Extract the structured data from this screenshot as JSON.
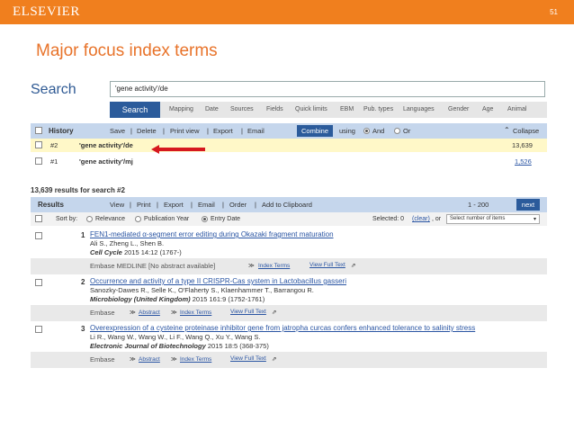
{
  "slide": {
    "brand": "ELSEVIER",
    "number": "51",
    "title": "Major focus index terms"
  },
  "search": {
    "label": "Search",
    "query": "'gene activity'/de",
    "button": "Search",
    "tabs": [
      "Mapping",
      "Date",
      "Sources",
      "Fields",
      "Quick limits",
      "EBM",
      "Pub. types",
      "Languages",
      "Gender",
      "Age",
      "Animal"
    ]
  },
  "history": {
    "label": "History",
    "actions": [
      "Save",
      "Delete",
      "Print view",
      "Export",
      "Email"
    ],
    "combine": "Combine",
    "using": "using",
    "and": "And",
    "or": "Or",
    "collapse": "Collapse",
    "rows": [
      {
        "id": "#2",
        "query": "'gene activity'/de",
        "count": "13,639"
      },
      {
        "id": "#1",
        "query": "'gene activity'/mj",
        "count": "1,526"
      }
    ]
  },
  "results": {
    "count_text": "13,639 results for search #2",
    "label": "Results",
    "actions": [
      "View",
      "Print",
      "Export",
      "Email",
      "Order",
      "Add to Clipboard"
    ],
    "range": "1 - 200",
    "next": "next",
    "sort_by": "Sort by:",
    "sort_options": [
      "Relevance",
      "Publication Year",
      "Entry Date"
    ],
    "selected_text": "Selected: 0",
    "clear": "(clear)",
    "or": ", or",
    "select_placeholder": "Select number of items",
    "items": [
      {
        "num": "1",
        "title": "FEN1-mediated α-segment error editing during Okazaki fragment maturation",
        "authors": "Ali S., Zheng L., Shen B.",
        "journal": "Cell Cycle",
        "journal_details": " 2015 14:12 (1767-)",
        "sources": "Embase   MEDLINE   [No abstract available]",
        "index_terms": "Index Terms",
        "full_text": "View Full Text"
      },
      {
        "num": "2",
        "title": "Occurrence and activity of a type II CRISPR-Cas system in Lactobacillus gasseri",
        "authors": "Sanozky-Dawes R., Selle K., O'Flaherty S., Klaenhammer T., Barrangou R.",
        "journal": "Microbiology (United Kingdom)",
        "journal_details": " 2015 161:9 (1752-1761)",
        "sources": "Embase",
        "abstract": "Abstract",
        "index_terms": "Index Terms",
        "full_text": "View Full Text"
      },
      {
        "num": "3",
        "title": "Overexpression of a cysteine proteinase inhibitor gene from jatropha curcas confers enhanced tolerance to salinity stress",
        "authors": "Li R., Wang W., Wang W., Li F., Wang Q., Xu Y., Wang S.",
        "journal": "Electronic Journal of Biotechnology",
        "journal_details": " 2015 18:5 (368-375)",
        "sources": "Embase",
        "abstract": "Abstract",
        "index_terms": "Index Terms",
        "full_text": "View Full Text"
      }
    ]
  },
  "colors": {
    "brand_orange": "#f07f1e",
    "primary_blue": "#2b5b9b",
    "highlight_row": "#fff8c8",
    "arrow_red": "#d6181f"
  }
}
